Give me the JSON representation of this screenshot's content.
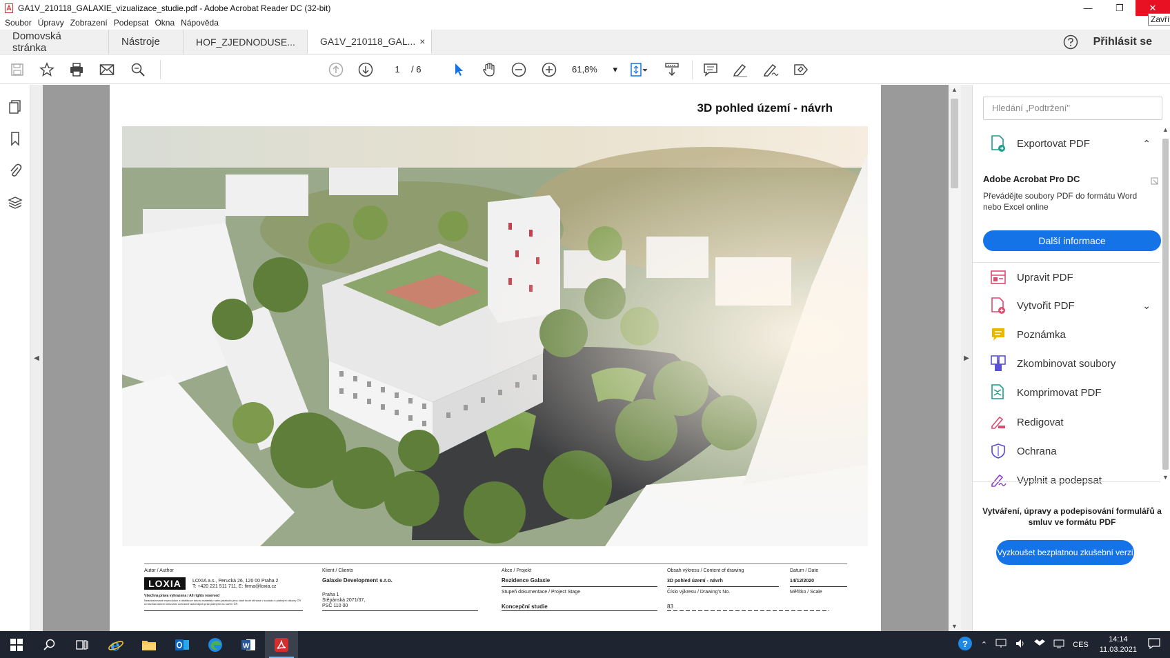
{
  "window": {
    "title": "GA1V_210118_GALAXIE_vizualizace_studie.pdf - Adobe Acrobat Reader DC (32-bit)",
    "close_tooltip": "Zavřít"
  },
  "menu": [
    "Soubor",
    "Úpravy",
    "Zobrazení",
    "Podepsat",
    "Okna",
    "Nápověda"
  ],
  "tabs": {
    "home": "Domovská stránka",
    "tools": "Nástroje",
    "doc1": "HOF_ZJEDNODUSE...",
    "doc2": "GA1V_210118_GAL...",
    "close_symbol": "×",
    "signin": "Přihlásit se"
  },
  "toolbar": {
    "page_current": "1",
    "page_total": "/ 6",
    "zoom": "61,8%"
  },
  "document": {
    "page_title": "3D pohled území - návrh",
    "titleblock": {
      "author_label": "Autor / Author",
      "author_logo": "LOXIA",
      "author_address": "LOXIA a.s., Perucká 26, 120 00 Praha 2",
      "author_contact": "T: +420 221 511 711, E: firma@loxia.cz",
      "rights_heading": "Všechna práva vyhrazena / All rights reserved",
      "rights_text": "Neautorizované reprodukce a distribuce tohoto materiálu nebo jakékoliv jeho části bude stíhána v souladu s platnými zákony ČR a mezinárodními úmluvami ochranně autorských práv platnými na území ČR.",
      "client_label": "Klient / Clients",
      "client_name": "Galaxie Development s.r.o.",
      "client_addr1": "Praha 1",
      "client_addr2": "Štěpánská 2071/37,",
      "client_addr3": "PSČ 110 00",
      "project_label": "Akce / Projekt",
      "project_name": "Rezidence Galaxie",
      "stage_label": "Stupeň dokumentace / Project Stage",
      "stage_value": "Koncepční studie",
      "content_label": "Obsah výkresu / Content of drawing",
      "content_value": "3D pohled území - návrh",
      "drawing_no_label": "Číslo výkresu / Drawing's No.",
      "drawing_no_value": "83",
      "date_label": "Datum / Date",
      "date_value": "14/12/2020",
      "scale_label": "Měřítko / Scale"
    }
  },
  "right_panel": {
    "search_placeholder": "Hledání „Podtržení\"",
    "export_label": "Exportovat PDF",
    "promo_title": "Adobe Acrobat Pro DC",
    "promo_text": "Převádějte soubory PDF do formátu Word nebo Excel online",
    "promo_button": "Další informace",
    "tools": [
      {
        "label": "Upravit PDF",
        "icon": "edit-pdf-icon",
        "color": "#e0486e"
      },
      {
        "label": "Vytvořit PDF",
        "icon": "create-pdf-icon",
        "color": "#e0486e"
      },
      {
        "label": "Poznámka",
        "icon": "comment-icon",
        "color": "#e6b800"
      },
      {
        "label": "Zkombinovat soubory",
        "icon": "combine-files-icon",
        "color": "#5a4fd6"
      },
      {
        "label": "Komprimovat PDF",
        "icon": "compress-pdf-icon",
        "color": "#1a9e8b"
      },
      {
        "label": "Redigovat",
        "icon": "redact-icon",
        "color": "#e0486e"
      },
      {
        "label": "Ochrana",
        "icon": "protect-icon",
        "color": "#5a4fd6"
      },
      {
        "label": "Vyplnit a podepsat",
        "icon": "fill-sign-icon",
        "color": "#8b3fd1"
      }
    ],
    "bottom_text": "Vytváření, úpravy a podepisování formulářů a smluv ve formátu PDF",
    "trial_button": "Vyzkoušet bezplatnou zkušební verzi"
  },
  "taskbar": {
    "lang": "CES",
    "time": "14:14",
    "date": "11.03.2021"
  },
  "colors": {
    "accent": "#1473e6",
    "close_red": "#e81123",
    "taskbar": "#1f2530"
  }
}
